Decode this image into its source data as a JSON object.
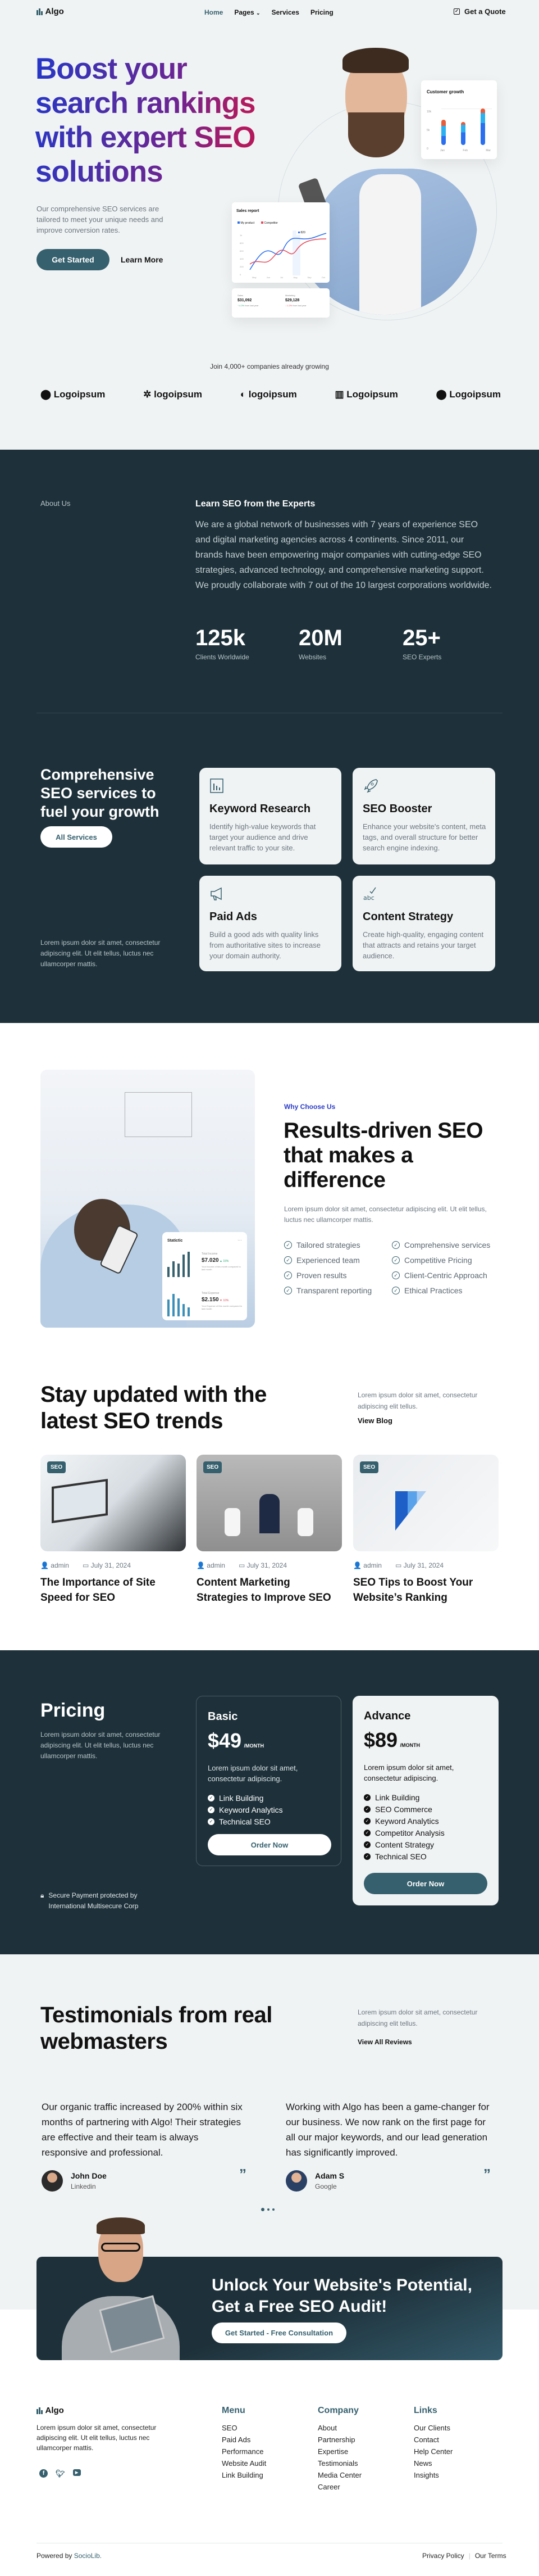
{
  "nav": {
    "logo": "Algo",
    "links": [
      "Home",
      "Pages",
      "Services",
      "Pricing"
    ],
    "quote": "Get a Quote"
  },
  "hero": {
    "headline_lines": [
      "Boost your",
      "search rankings",
      "with expert SEO",
      "solutions"
    ],
    "subtitle": "Our comprehensive SEO services are tailored to meet your unique needs and improve conversion rates.",
    "cta_primary": "Get Started",
    "cta_secondary": "Learn More",
    "growth_card": {
      "title": "Customer growth",
      "y_ticks": [
        "10k",
        "5k",
        "0"
      ],
      "months": [
        "Jan",
        "Feb",
        "Mar"
      ]
    },
    "sales_card": {
      "title": "Sales report",
      "legend": [
        "My product",
        "Competitor"
      ],
      "y_ticks": [
        "1k",
        "800",
        "600",
        "400",
        "200",
        "0"
      ],
      "months": [
        "May",
        "Jun",
        "Jul",
        "Aug",
        "Sep",
        "Oct"
      ],
      "tooltip": "820"
    },
    "kpi_card": {
      "sales_label": "Sales",
      "sales_value": "$31,092",
      "sales_change": "↑ 4.2%",
      "sales_note": "from last year",
      "mkt_label": "Marketing",
      "mkt_value": "$29,128",
      "mkt_change": "↓ 1.2%",
      "mkt_note": "from last year"
    }
  },
  "clients": {
    "caption": "Join 4,000+ companies already growing",
    "logos": [
      "Logoipsum",
      "logoipsum",
      "logoipsum",
      "Logoipsum",
      "Logoipsum"
    ]
  },
  "about": {
    "label": "About Us",
    "title": "Learn SEO from the Experts",
    "body": "We are a global network of businesses with 7 years of experience SEO and digital marketing agencies across 4 continents. Since 2011, our brands have been empowering major companies with cutting-edge SEO strategies, advanced technology, and comprehensive marketing support. We proudly collaborate with 7 out of the 10 largest corporations worldwide.",
    "stats": [
      {
        "value": "125k",
        "label": "Clients Worldwide"
      },
      {
        "value": "20M",
        "label": "Websites"
      },
      {
        "value": "25+",
        "label": "SEO Experts"
      }
    ]
  },
  "services": {
    "title": "Comprehensive SEO services to fuel your growth",
    "button": "All Services",
    "note": "Lorem ipsum dolor sit amet, consectetur adipiscing elit. Ut elit tellus, luctus nec ullamcorper mattis.",
    "items": [
      {
        "icon": "bar-chart-icon",
        "title": "Keyword Research",
        "desc": "Identify high-value keywords that target your audience and drive relevant traffic to your site."
      },
      {
        "icon": "rocket-icon",
        "title": "SEO Booster",
        "desc": "Enhance your website's content, meta tags, and overall structure for better search engine indexing."
      },
      {
        "icon": "megaphone-icon",
        "title": "Paid Ads",
        "desc": "Build a good ads with quality links from authoritative sites to increase your domain authority."
      },
      {
        "icon": "spellcheck-icon",
        "title": "Content Strategy",
        "desc": "Create high-quality, engaging content that attracts and retains your target audience."
      }
    ]
  },
  "why": {
    "label": "Why Choose Us",
    "title": "Results-driven SEO that makes a difference",
    "body": "Lorem ipsum dolor sit amet, consectetur adipiscing elit. Ut elit tellus, luctus nec ullamcorper mattis.",
    "features": [
      "Tailored strategies",
      "Experienced team",
      "Proven results",
      "Transparent reporting",
      "Comprehensive services",
      "Competitive Pricing",
      "Client-Centric Approach",
      "Ethical Practices"
    ],
    "stat_card": {
      "title": "Statictic",
      "income_label": "Total Income",
      "income_value": "$7.020",
      "income_change": "15%",
      "income_note": "Your Income of this month compared to last month",
      "expense_label": "Total Expense",
      "expense_value": "$2.150",
      "expense_change": "10%",
      "expense_note": "Your Expense of this month compared to last month"
    }
  },
  "blog": {
    "title": "Stay updated with the latest SEO trends",
    "body": "Lorem ipsum dolor sit amet, consectetur adipiscing elit tellus.",
    "link": "View Blog",
    "posts": [
      {
        "tag": "SEO",
        "author": "admin",
        "date": "July 31, 2024",
        "title": "The Importance of Site Speed for SEO"
      },
      {
        "tag": "SEO",
        "author": "admin",
        "date": "July 31, 2024",
        "title": "Content Marketing Strategies to Improve SEO"
      },
      {
        "tag": "SEO",
        "author": "admin",
        "date": "July 31, 2024",
        "title": "SEO Tips to Boost Your Website’s Ranking"
      }
    ]
  },
  "pricing": {
    "title": "Pricing",
    "body": "Lorem ipsum dolor sit amet, consectetur adipiscing elit. Ut elit tellus, luctus nec ullamcorper mattis.",
    "secure": "Secure Payment protected by International Multisecure Corp",
    "plans": [
      {
        "name": "Basic",
        "price": "$49",
        "period": "/MONTH",
        "desc": "Lorem ipsum dolor sit amet, consectetur adipiscing.",
        "features": [
          "Link Building",
          "Keyword Analytics",
          "Technical SEO"
        ],
        "button": "Order Now"
      },
      {
        "name": "Advance",
        "price": "$89",
        "period": "/MONTH",
        "desc": "Lorem ipsum dolor sit amet, consectetur adipiscing.",
        "features": [
          "Link Building",
          "SEO Commerce",
          "Keyword Analytics",
          "Competitor Analysis",
          "Content Strategy",
          "Technical SEO"
        ],
        "button": "Order Now"
      }
    ]
  },
  "testimonials": {
    "title": "Testimonials from real webmasters",
    "body": "Lorem ipsum dolor sit amet, consectetur adipiscing elit tellus.",
    "link": "View All Reviews",
    "items": [
      {
        "quote": "Our organic traffic increased by 200% within six months of partnering with Algo! Their strategies are effective and their team is always responsive and professional.",
        "name": "John Doe",
        "source": "Linkedin"
      },
      {
        "quote": "Working with Algo has been a game-changer for our business. We now rank on the first page for all our major keywords, and our lead generation has significantly improved.",
        "name": "Adam S",
        "source": "Google"
      }
    ]
  },
  "cta": {
    "title": "Unlock Your Website's Potential, Get a Free SEO Audit!",
    "button": "Get Started - Free Consultation"
  },
  "footer": {
    "logo": "Algo",
    "body": "Lorem ipsum dolor sit amet, consectetur adipiscing elit. Ut elit tellus, luctus nec ullamcorper mattis.",
    "columns": [
      {
        "title": "Menu",
        "links": [
          "SEO",
          "Paid Ads",
          "Performance",
          "Website Audit",
          "Link Building"
        ]
      },
      {
        "title": "Company",
        "links": [
          "About",
          "Partnership",
          "Expertise",
          "Testimonials",
          "Media Center",
          "Career"
        ]
      },
      {
        "title": "Links",
        "links": [
          "Our Clients",
          "Contact",
          "Help Center",
          "News",
          "Insights"
        ]
      }
    ],
    "powered_prefix": "Powered by",
    "powered_brand": "SocioLib.",
    "legal": [
      "Privacy Policy",
      "Our Terms"
    ]
  },
  "colors": {
    "dark": "#1e313a",
    "accent": "#36606e",
    "background": "#f0f3f4",
    "why_label": "#2a3bc7"
  }
}
